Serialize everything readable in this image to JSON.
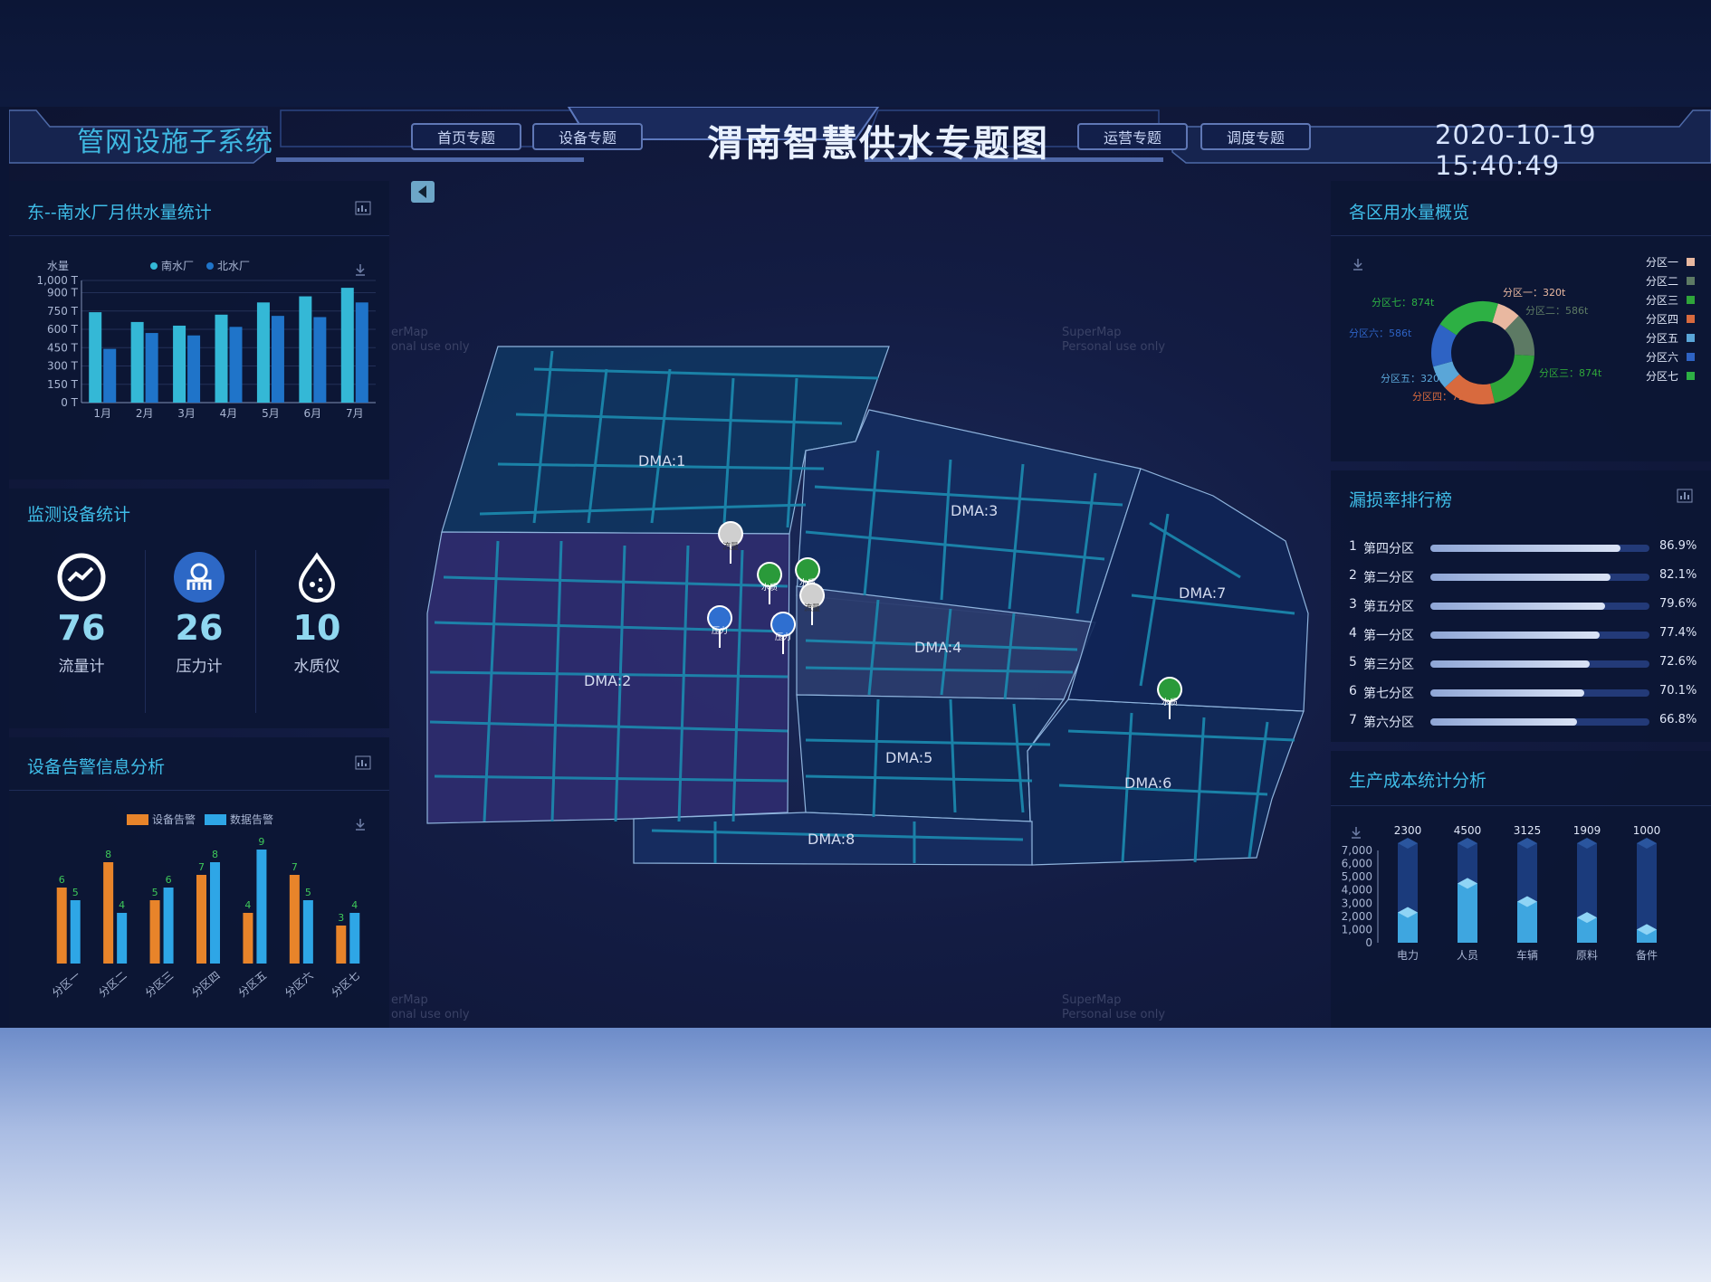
{
  "header": {
    "system_name": "管网设施子系统",
    "title": "渭南智慧供水专题图",
    "datetime": "2020-10-19 15:40:49",
    "nav_left": [
      "首页专题",
      "设备专题"
    ],
    "nav_right": [
      "运营专题",
      "调度专题"
    ]
  },
  "panels": {
    "supply": {
      "title": "东--南水厂月供水量统计",
      "chart": {
        "type": "bar",
        "ylabel": "水量",
        "legend": [
          "南水厂",
          "北水厂"
        ],
        "categories": [
          "1月",
          "2月",
          "3月",
          "4月",
          "5月",
          "6月",
          "7月"
        ],
        "yticks": [
          "1,000 T",
          "900 T",
          "750 T",
          "600 T",
          "450 T",
          "300 T",
          "150 T",
          "0 T"
        ],
        "ylim": [
          0,
          1000
        ],
        "series": [
          {
            "name": "南水厂",
            "values": [
              740,
              660,
              630,
              720,
              820,
              870,
              940
            ]
          },
          {
            "name": "北水厂",
            "values": [
              440,
              570,
              550,
              620,
              710,
              700,
              820
            ]
          }
        ]
      }
    },
    "devices": {
      "title": "监测设备统计",
      "items": [
        {
          "count": "76",
          "label": "流量计",
          "icon": "flow-meter-icon"
        },
        {
          "count": "26",
          "label": "压力计",
          "icon": "pressure-meter-icon"
        },
        {
          "count": "10",
          "label": "水质仪",
          "icon": "water-quality-icon"
        }
      ]
    },
    "alarms": {
      "title": "设备告警信息分析",
      "chart": {
        "type": "bar",
        "legend": [
          "设备告警",
          "数据告警"
        ],
        "categories": [
          "分区一",
          "分区二",
          "分区三",
          "分区四",
          "分区五",
          "分区六",
          "分区七"
        ],
        "ylim": [
          0,
          10
        ],
        "series": [
          {
            "name": "设备告警",
            "values": [
              6,
              8,
              5,
              7,
              4,
              7,
              3
            ]
          },
          {
            "name": "数据告警",
            "values": [
              5,
              4,
              6,
              8,
              9,
              5,
              4
            ]
          }
        ]
      }
    },
    "usage": {
      "title": "各区用水量概览",
      "chart": {
        "type": "pie",
        "legend": [
          "分区一",
          "分区二",
          "分区三",
          "分区四",
          "分区五",
          "分区六",
          "分区七"
        ],
        "labels": [
          "分区一：320t",
          "分区二：586t",
          "分区三：874t",
          "分区四：725t",
          "分区五：320t",
          "分区六：586t",
          "分区七：874t"
        ],
        "values": [
          320,
          586,
          874,
          725,
          320,
          586,
          874
        ],
        "colors": [
          "#e9b8a0",
          "#5d7a64",
          "#2fa53a",
          "#d86a3e",
          "#5aa6d8",
          "#2e63c4",
          "#2db044"
        ]
      }
    },
    "leak": {
      "title": "漏损率排行榜",
      "rows": [
        {
          "rank": "1",
          "name": "第四分区",
          "pct": "86.9%",
          "value": 0.869
        },
        {
          "rank": "2",
          "name": "第二分区",
          "pct": "82.1%",
          "value": 0.821
        },
        {
          "rank": "3",
          "name": "第五分区",
          "pct": "79.6%",
          "value": 0.796
        },
        {
          "rank": "4",
          "name": "第一分区",
          "pct": "77.4%",
          "value": 0.774
        },
        {
          "rank": "5",
          "name": "第三分区",
          "pct": "72.6%",
          "value": 0.726
        },
        {
          "rank": "6",
          "name": "第七分区",
          "pct": "70.1%",
          "value": 0.701
        },
        {
          "rank": "7",
          "name": "第六分区",
          "pct": "66.8%",
          "value": 0.668
        }
      ]
    },
    "cost": {
      "title": "生产成本统计分析",
      "chart": {
        "type": "bar",
        "categories": [
          "电力",
          "人员",
          "车辆",
          "原料",
          "备件"
        ],
        "top_labels": [
          "2300",
          "4500",
          "3125",
          "1909",
          "1000"
        ],
        "values": [
          2300,
          4500,
          3125,
          1909,
          1000
        ],
        "yticks": [
          "7,000",
          "6,000",
          "5,000",
          "4,000",
          "3,000",
          "2,000",
          "1,000",
          "0"
        ],
        "ylim": [
          0,
          7000
        ]
      }
    }
  },
  "map": {
    "zones": [
      "DMA:1",
      "DMA:2",
      "DMA:3",
      "DMA:4",
      "DMA:5",
      "DMA:6",
      "DMA:7",
      "DMA:8"
    ],
    "markers": [
      "流量",
      "水质",
      "水质",
      "流量",
      "压力",
      "压力",
      "水质"
    ],
    "watermark": [
      "SuperMap",
      "Personal use only"
    ],
    "watermark_partial": [
      "erMap",
      "onal use only"
    ]
  },
  "colors": {
    "accent": "#3fbde8",
    "south": "#34b8d6",
    "north": "#1f74c9",
    "alarm_device": "#e8842a",
    "alarm_data": "#2ea6e6"
  }
}
